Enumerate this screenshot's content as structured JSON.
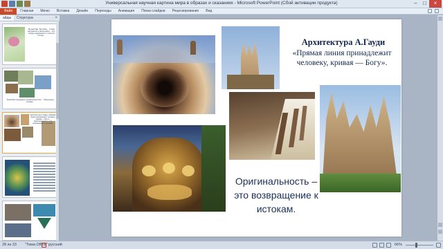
{
  "window": {
    "title": "Универсальная научная картина мира в образах и сказаниях - Microsoft PowerPoint (Сбой активации продукта)",
    "minimize": "–",
    "maximize": "□",
    "close": "×"
  },
  "ribbon": {
    "file_tab": "Файл",
    "tabs": [
      "Главная",
      "Меню",
      "Вставка",
      "Дизайн",
      "Переходы",
      "Анимация",
      "Показ слайдов",
      "Рецензирование",
      "Вид"
    ]
  },
  "left_pane": {
    "tab_slides": "айды",
    "tab_outline": "Структура",
    "close": "×",
    "thumbnails": [
      {
        "number": "",
        "text": "Музыка Бах, Бетховен… Сплав математики и философии… Кто-нибудь задумывался о понятии истины…"
      },
      {
        "number": "",
        "text": "Какой Мир придумали человеческие боги… Образ мира, человек…"
      },
      {
        "number": "",
        "text": "Архитектура А.Гауди «Прямая линия принадлежит человеку, кривая — Богу». Оригинальность – это возвращение к истокам."
      },
      {
        "number": "",
        "text": ""
      },
      {
        "number": "",
        "text": ""
      }
    ]
  },
  "slide": {
    "title": "Архитектура А.Гауди",
    "quote": "«Прямая линия принадлежит человеку, кривая — Богу».",
    "originality": "Оригинальность – это возвращение к истокам."
  },
  "status": {
    "slide_counter": "28 из 33",
    "theme": "\"Тема Office\"",
    "language": "русский",
    "zoom": "66%"
  },
  "colors": {
    "file_tab": "#c84a26",
    "slide_text": "#14284f",
    "thumb_active_border": "#e2a84a"
  }
}
